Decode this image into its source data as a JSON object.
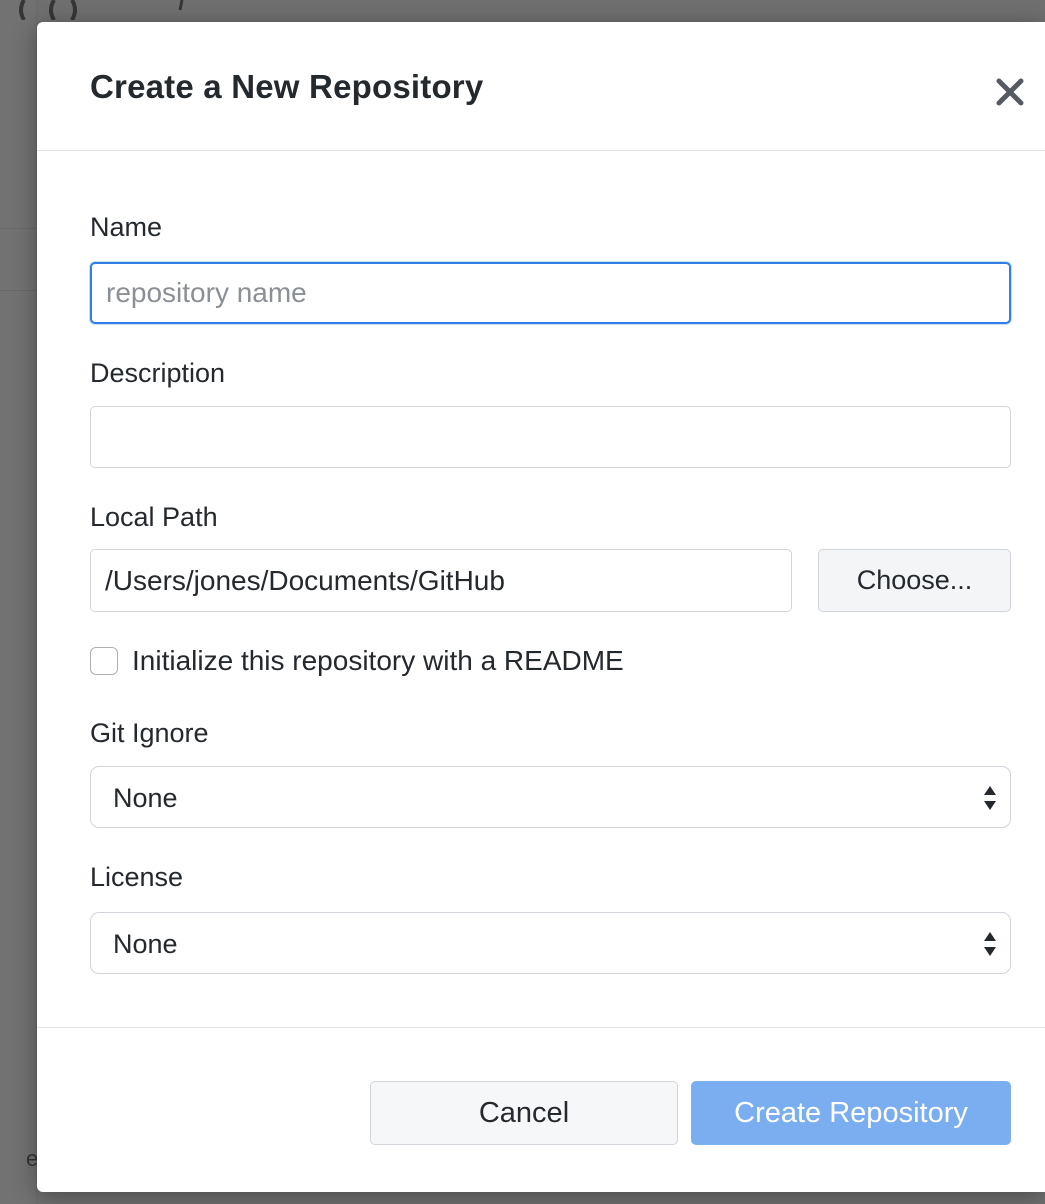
{
  "background": {
    "partial_letter": "e"
  },
  "dialog": {
    "title": "Create a New Repository",
    "close_icon": "close-icon"
  },
  "form": {
    "name": {
      "label": "Name",
      "value": "",
      "placeholder": "repository name",
      "focused": true
    },
    "description": {
      "label": "Description",
      "value": "",
      "placeholder": ""
    },
    "local_path": {
      "label": "Local Path",
      "value": "/Users/jones/Documents/GitHub",
      "choose_label": "Choose..."
    },
    "readme": {
      "label": "Initialize this repository with a README",
      "checked": false
    },
    "git_ignore": {
      "label": "Git Ignore",
      "selected": "None",
      "icon": "select-arrows-icon"
    },
    "license": {
      "label": "License",
      "selected": "None",
      "icon": "select-arrows-icon"
    }
  },
  "footer": {
    "cancel_label": "Cancel",
    "create_label": "Create Repository"
  },
  "colors": {
    "accent": "#2f7fe6",
    "primary_button_disabled": "#7aaef0",
    "overlay": "#3c3c3c"
  }
}
